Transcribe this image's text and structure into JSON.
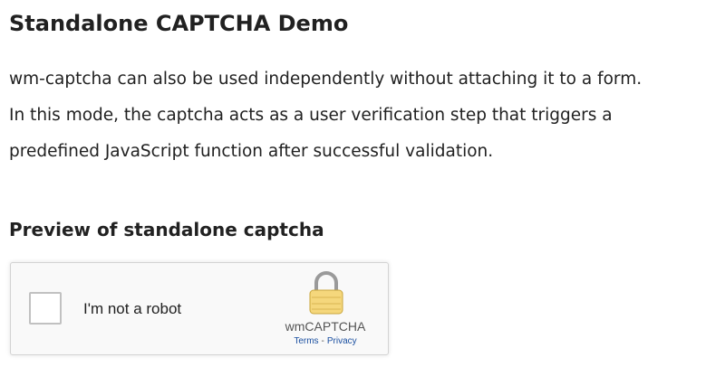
{
  "page": {
    "title": "Standalone CAPTCHA Demo",
    "description_lines": [
      "wm-captcha can also be used independently without attaching it to a form.",
      "In this mode, the captcha acts as a user verification step that triggers a",
      "predefined JavaScript function after successful validation."
    ],
    "section_title": "Preview of standalone captcha"
  },
  "captcha": {
    "checkbox_checked": false,
    "label": "I'm not a robot",
    "brand": "wmCAPTCHA",
    "terms_link": "Terms",
    "separator": "-",
    "privacy_link": "Privacy",
    "logo_icon": "lock-icon",
    "colors": {
      "lock_body": "#f5d77c",
      "lock_shackle": "#9a9a9a",
      "link": "#1a4fa0",
      "widget_background": "#f9f9f9",
      "widget_border": "#d3d3d3"
    }
  }
}
